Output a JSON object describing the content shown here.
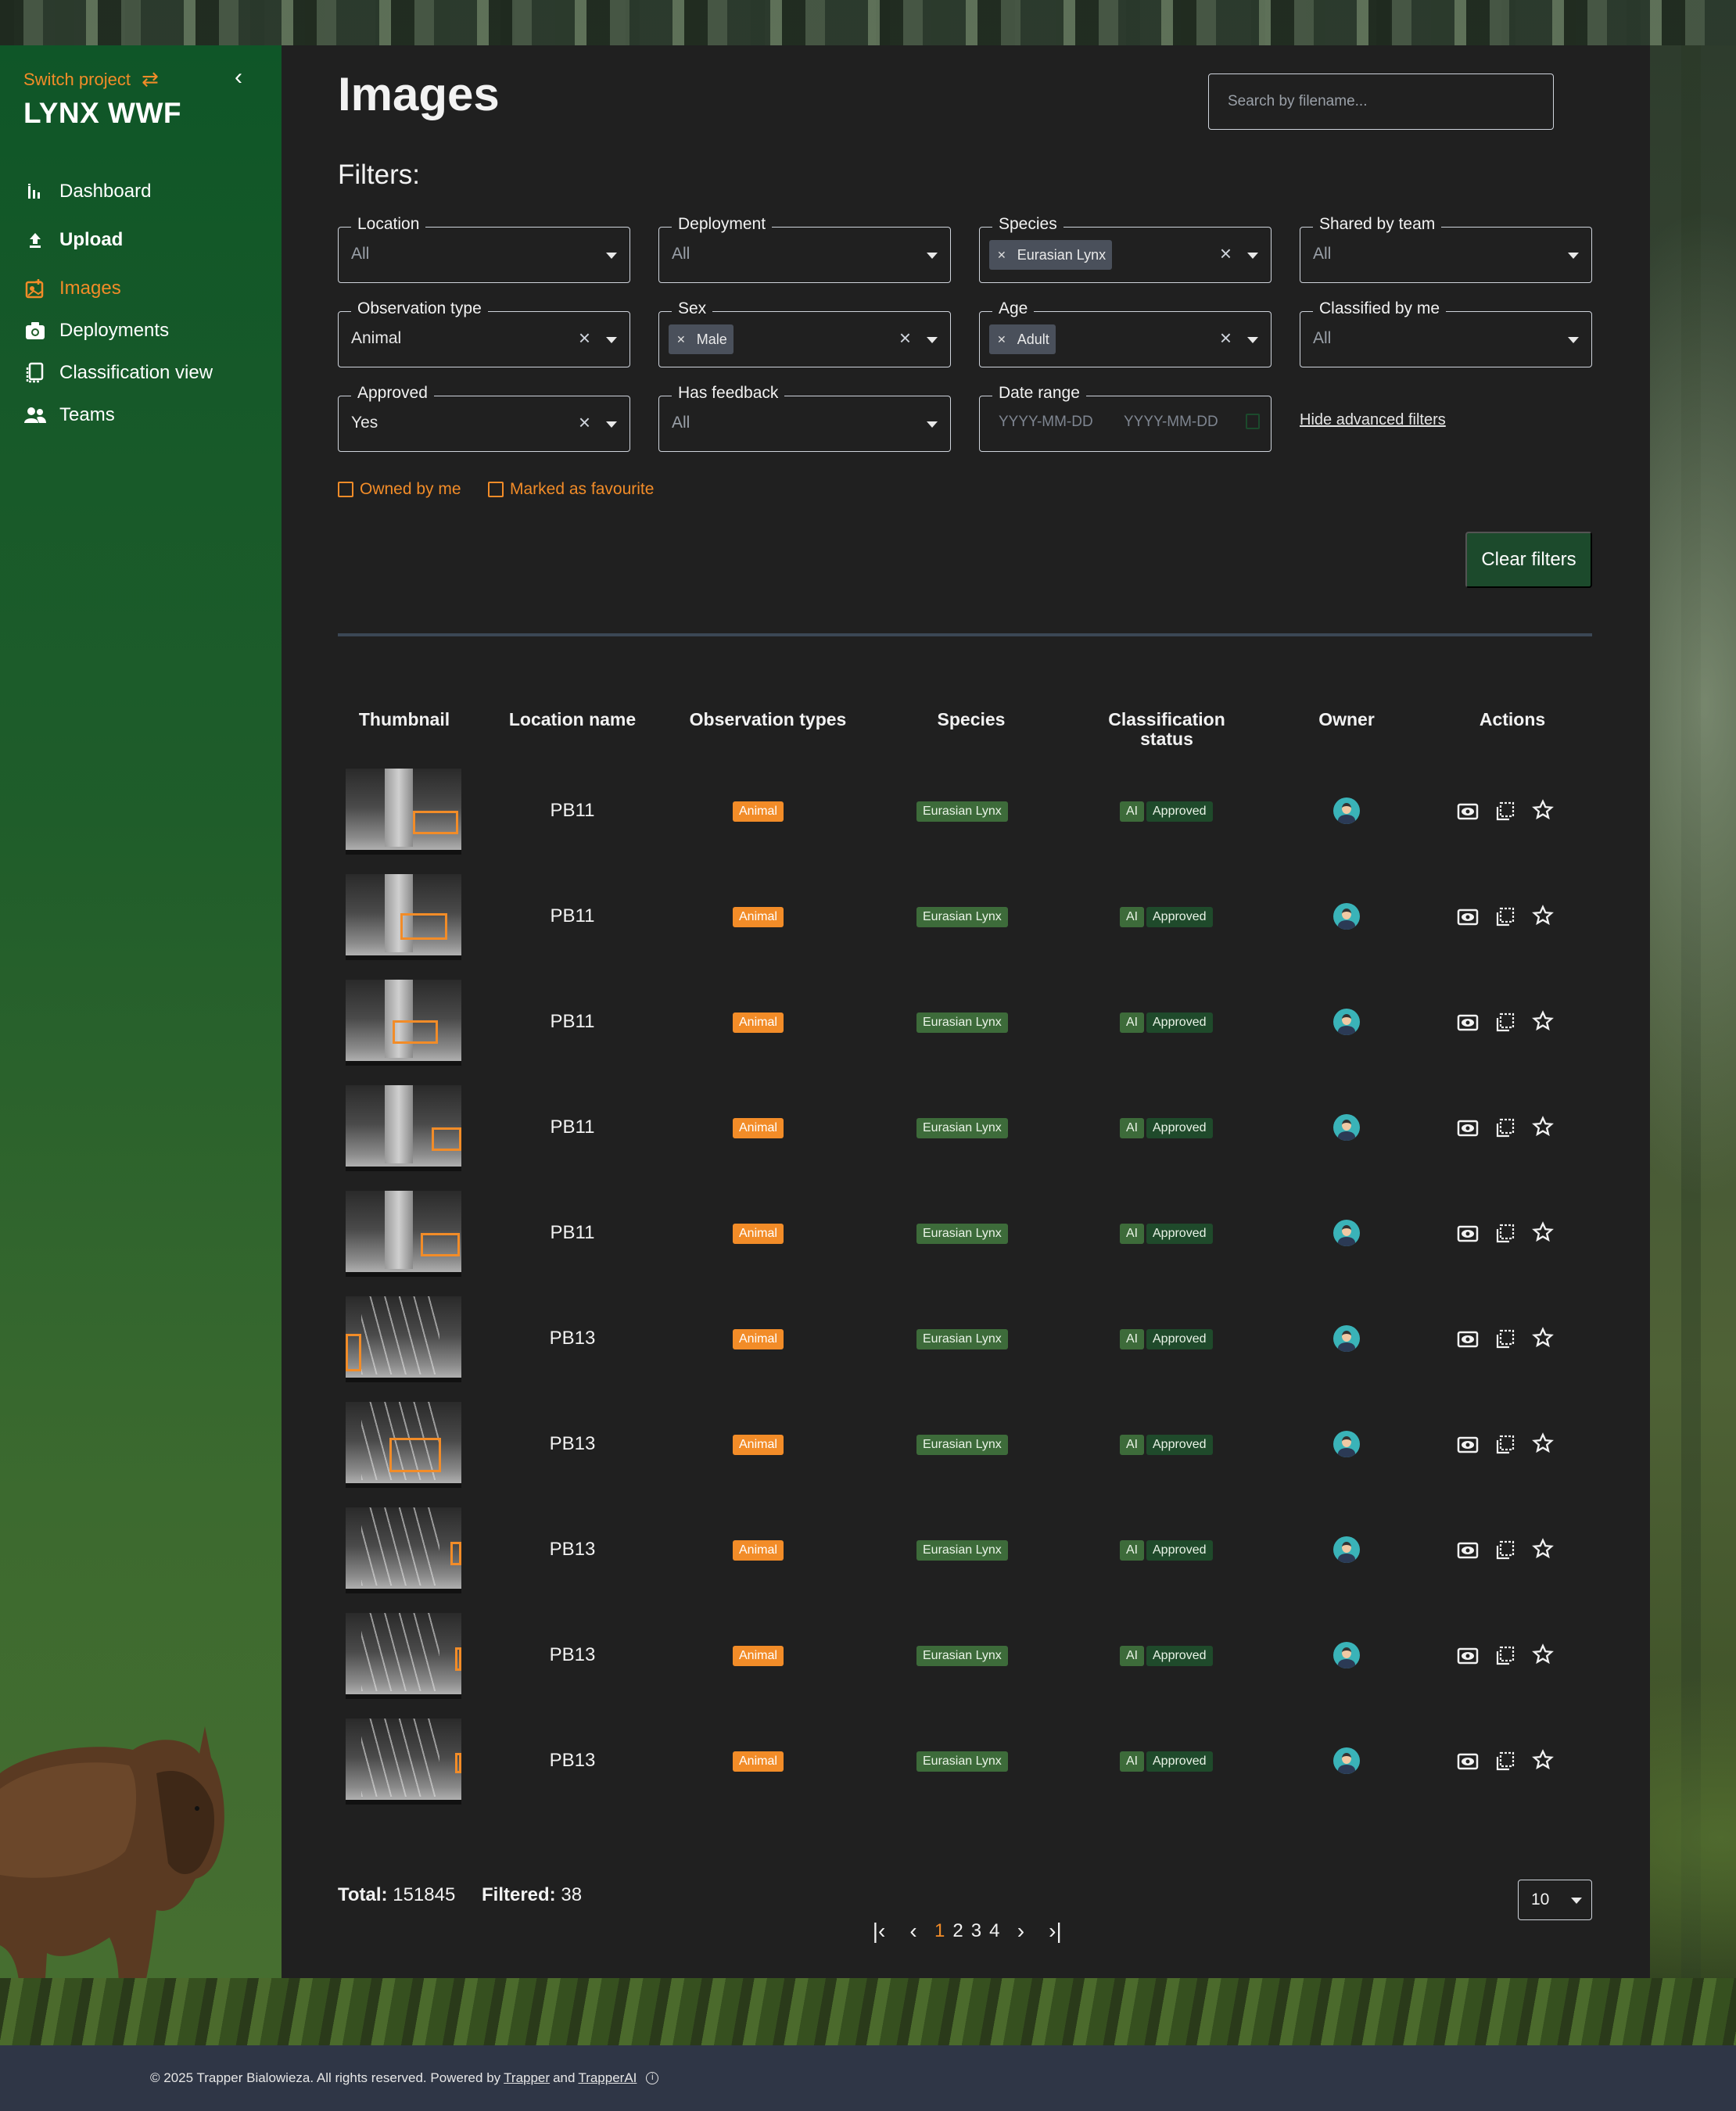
{
  "sidebar": {
    "switch_project": "Switch project",
    "project_name": "LYNX WWF",
    "items": [
      {
        "label": "Dashboard",
        "icon": "dashboard-icon"
      },
      {
        "label": "Upload",
        "icon": "upload-icon"
      },
      {
        "label": "Images",
        "icon": "images-icon",
        "active": true
      },
      {
        "label": "Deployments",
        "icon": "camera-icon"
      },
      {
        "label": "Classification view",
        "icon": "classification-icon"
      },
      {
        "label": "Teams",
        "icon": "teams-icon"
      }
    ]
  },
  "header": {
    "title": "Images",
    "search_placeholder": "Search by filename..."
  },
  "filters": {
    "title": "Filters:",
    "location": {
      "label": "Location",
      "value": "All"
    },
    "deployment": {
      "label": "Deployment",
      "value": "All"
    },
    "species": {
      "label": "Species",
      "chip": "Eurasian Lynx"
    },
    "shared_by_team": {
      "label": "Shared by team",
      "value": "All"
    },
    "observation_type": {
      "label": "Observation type",
      "value": "Animal"
    },
    "sex": {
      "label": "Sex",
      "chip": "Male"
    },
    "age": {
      "label": "Age",
      "chip": "Adult"
    },
    "classified_by_me": {
      "label": "Classified by me",
      "value": "All"
    },
    "approved": {
      "label": "Approved",
      "value": "Yes"
    },
    "has_feedback": {
      "label": "Has feedback",
      "value": "All"
    },
    "date_range": {
      "label": "Date range",
      "from_placeholder": "YYYY-MM-DD",
      "to_placeholder": "YYYY-MM-DD"
    },
    "hide_advanced": "Hide advanced filters",
    "owned_by_me": "Owned by me",
    "marked_favourite": "Marked as favourite",
    "clear_button": "Clear filters"
  },
  "table": {
    "columns": [
      "Thumbnail",
      "Location name",
      "Observation types",
      "Species",
      "Classification status",
      "Owner",
      "Actions"
    ],
    "column_status_line1": "Classification",
    "column_status_line2": "status",
    "rows": [
      {
        "location": "PB11",
        "observation": "Animal",
        "species": "Eurasian Lynx",
        "classifier": "AI",
        "status": "Approved"
      },
      {
        "location": "PB11",
        "observation": "Animal",
        "species": "Eurasian Lynx",
        "classifier": "AI",
        "status": "Approved"
      },
      {
        "location": "PB11",
        "observation": "Animal",
        "species": "Eurasian Lynx",
        "classifier": "AI",
        "status": "Approved"
      },
      {
        "location": "PB11",
        "observation": "Animal",
        "species": "Eurasian Lynx",
        "classifier": "AI",
        "status": "Approved"
      },
      {
        "location": "PB11",
        "observation": "Animal",
        "species": "Eurasian Lynx",
        "classifier": "AI",
        "status": "Approved"
      },
      {
        "location": "PB13",
        "observation": "Animal",
        "species": "Eurasian Lynx",
        "classifier": "AI",
        "status": "Approved"
      },
      {
        "location": "PB13",
        "observation": "Animal",
        "species": "Eurasian Lynx",
        "classifier": "AI",
        "status": "Approved"
      },
      {
        "location": "PB13",
        "observation": "Animal",
        "species": "Eurasian Lynx",
        "classifier": "AI",
        "status": "Approved"
      },
      {
        "location": "PB13",
        "observation": "Animal",
        "species": "Eurasian Lynx",
        "classifier": "AI",
        "status": "Approved"
      },
      {
        "location": "PB13",
        "observation": "Animal",
        "species": "Eurasian Lynx",
        "classifier": "AI",
        "status": "Approved"
      }
    ]
  },
  "summary": {
    "total_label": "Total:",
    "total_value": "151845",
    "filtered_label": "Filtered:",
    "filtered_value": "38"
  },
  "pagination": {
    "pages": [
      "1",
      "2",
      "3",
      "4"
    ],
    "current": "1",
    "page_size": "10"
  },
  "footer": {
    "text": "© 2025 Trapper Bialowieza. All rights reserved. Powered by",
    "link1": "Trapper",
    "and": "and",
    "link2": "TrapperAI"
  },
  "colors": {
    "accent": "#f28c28",
    "sidebar_green": "#0f5628",
    "panel": "#202020",
    "approved_badge": "#1f4a2b",
    "species_badge": "#3d6b3a"
  }
}
